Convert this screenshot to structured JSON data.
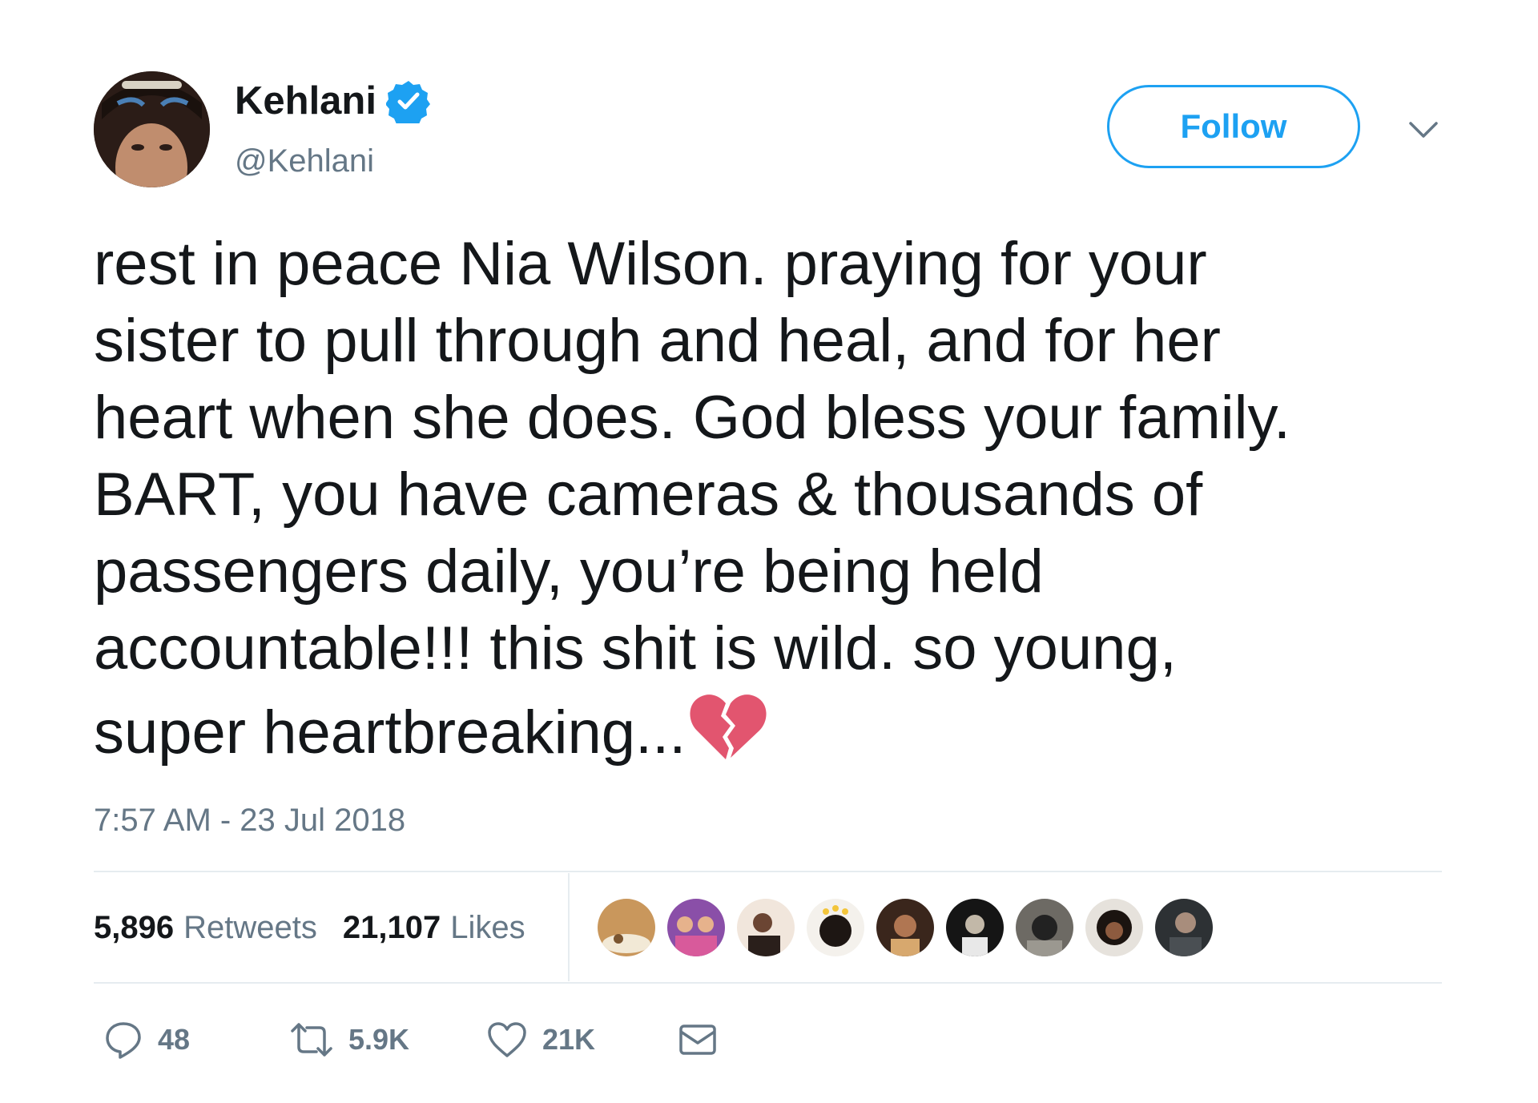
{
  "user": {
    "display_name": "Kehlani",
    "handle": "@Kehlani",
    "verified": true
  },
  "follow_button": {
    "label": "Follow"
  },
  "tweet": {
    "lines": [
      "rest in peace Nia Wilson. praying for your",
      "sister to pull through and heal, and for her",
      "heart when she does. God bless your family.",
      "BART, you have cameras & thousands of",
      "passengers daily, you’re being held",
      "accountable!!! this shit is wild. so young,",
      "super heartbreaking..."
    ],
    "emoji": "broken-heart-icon",
    "timestamp": "7:57 AM - 23 Jul 2018"
  },
  "stats": {
    "retweets_count": "5,896",
    "retweets_label": "Retweets",
    "likes_count": "21,107",
    "likes_label": "Likes"
  },
  "actions": {
    "replies": "48",
    "retweets": "5.9K",
    "likes": "21K"
  },
  "icons": [
    "verified-icon",
    "chevron-down-icon",
    "reply-icon",
    "retweet-icon",
    "heart-icon",
    "mail-icon",
    "broken-heart-icon"
  ],
  "colors": {
    "accent": "#1da1f2",
    "text": "#14171a",
    "muted": "#657786",
    "divider": "#e6ecf0",
    "broken_heart": "#e2556f"
  }
}
